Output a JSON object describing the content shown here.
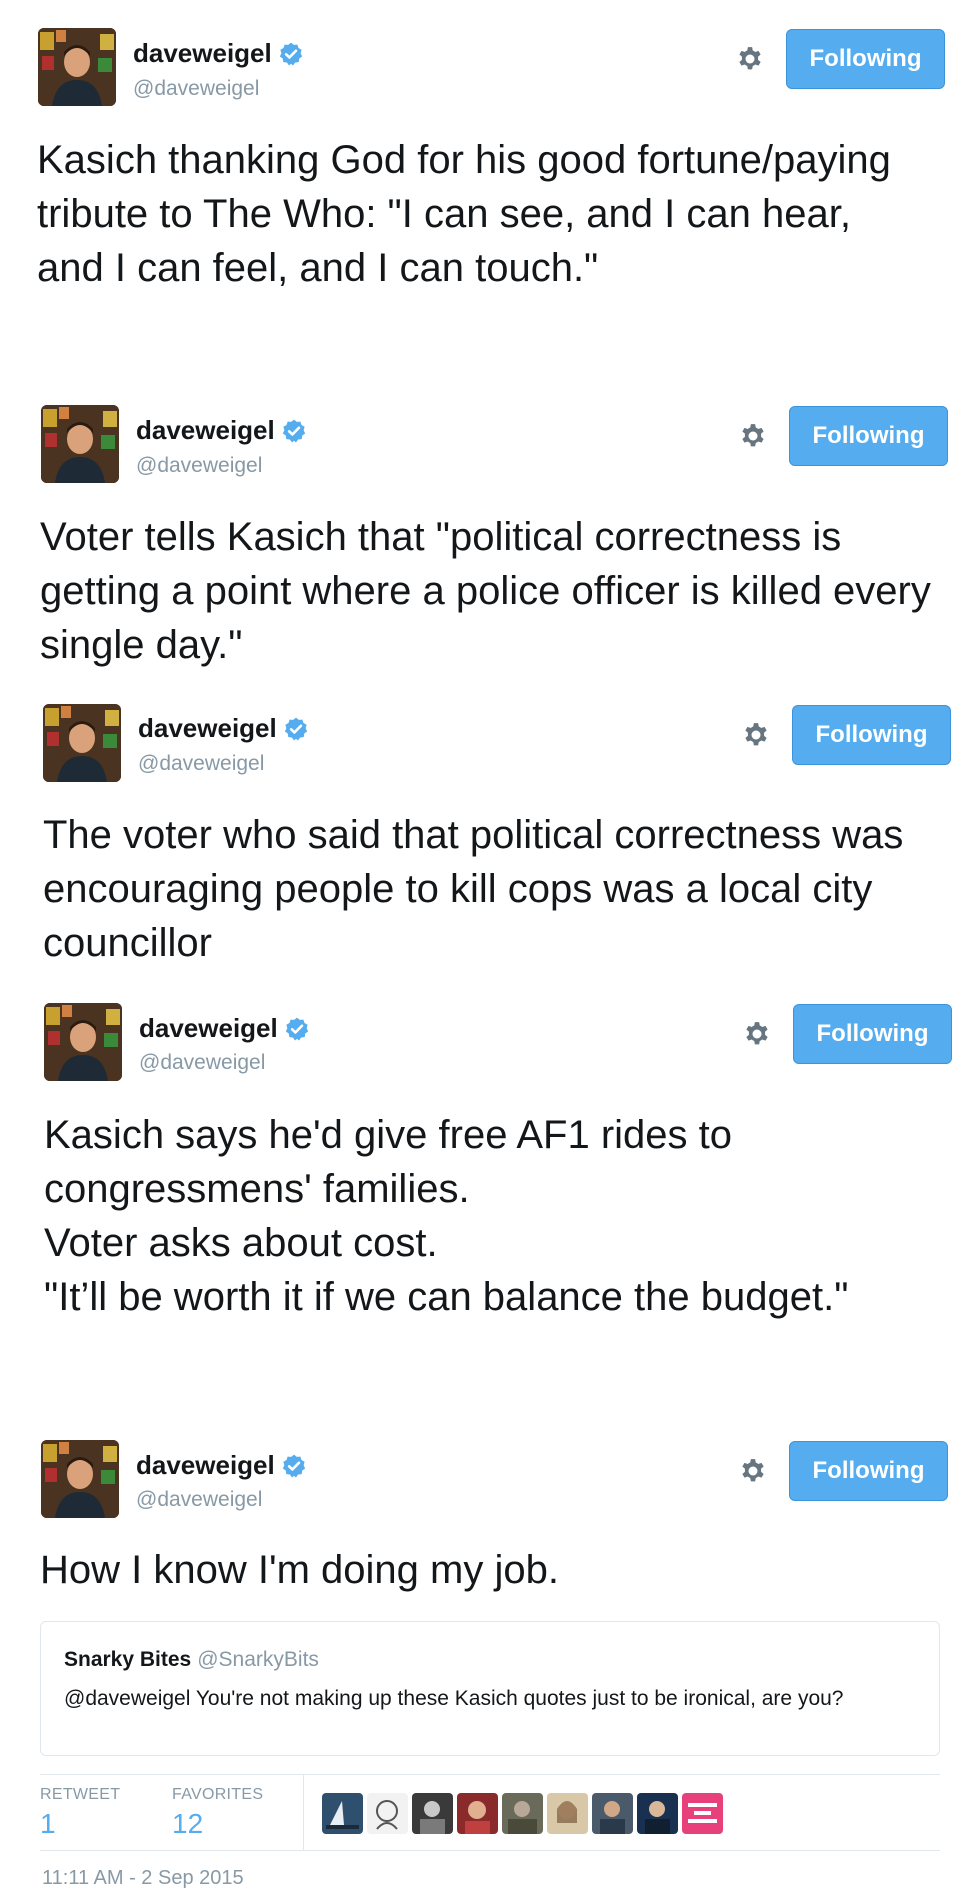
{
  "colors": {
    "accent": "#55acee",
    "verified": "#55acee",
    "muted": "#8899a6",
    "text": "#14171a",
    "border": "#e1e8ed"
  },
  "icons": {
    "verified": "verified-badge-icon",
    "gear": "gear-icon"
  },
  "tweets": [
    {
      "name": "daveweigel",
      "handle": "@daveweigel",
      "follow_label": "Following",
      "text": "Kasich thanking God for his good fortune/paying tribute to The Who: \"I can see, and I can hear, and I can feel, and I can touch.\""
    },
    {
      "name": "daveweigel",
      "handle": "@daveweigel",
      "follow_label": "Following",
      "text": "Voter tells Kasich that \"political correctness is getting a point where a police officer is killed every single day.\""
    },
    {
      "name": "daveweigel",
      "handle": "@daveweigel",
      "follow_label": "Following",
      "text": "The voter who said that political correctness was encouraging people to kill cops was a local city councillor"
    },
    {
      "name": "daveweigel",
      "handle": "@daveweigel",
      "follow_label": "Following",
      "text": "Kasich says he'd give free AF1 rides to congressmens' families.\nVoter asks about cost.\n\"It’ll be worth it if we can balance the budget.\""
    },
    {
      "name": "daveweigel",
      "handle": "@daveweigel",
      "follow_label": "Following",
      "text": "How I know I'm doing my job."
    }
  ],
  "quote": {
    "name": "Snarky Bites",
    "handle": "@SnarkyBits",
    "text": "@daveweigel You're not making up these Kasich quotes just to be ironical, are you?"
  },
  "stats": {
    "retweet_label": "RETWEET",
    "retweet_count": "1",
    "favorites_label": "FAVORITES",
    "favorites_count": "12"
  },
  "timestamp": "11:11 AM - 2 Sep 2015"
}
